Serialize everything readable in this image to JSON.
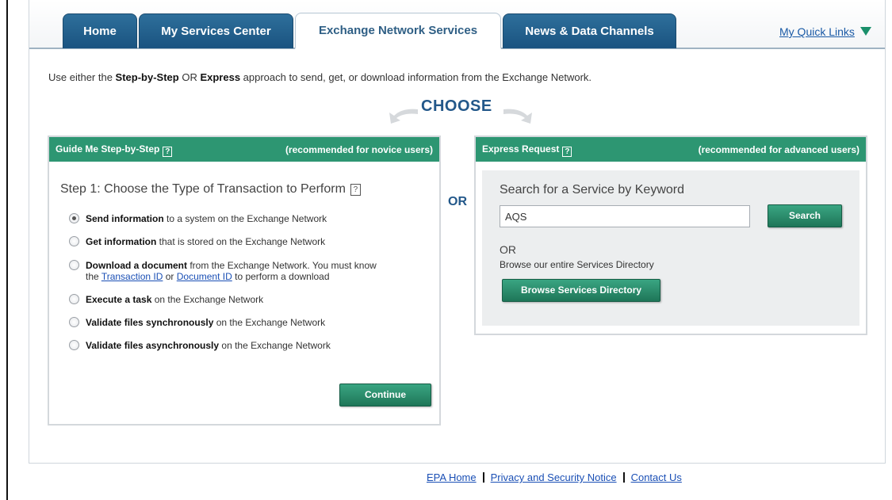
{
  "nav": {
    "tabs": [
      {
        "label": "Home"
      },
      {
        "label": "My Services Center"
      },
      {
        "label": "Exchange Network Services"
      },
      {
        "label": "News & Data Channels"
      }
    ],
    "quick_links": "My Quick Links"
  },
  "intro": {
    "part1": "Use either the ",
    "step": "Step-by-Step",
    "part2": " OR ",
    "express": "Express",
    "part3": " approach to send, get, or download information from the Exchange Network."
  },
  "choose_label": "CHOOSE",
  "or_label": "OR",
  "guide_panel": {
    "title": "Guide Me Step-by-Step",
    "recommendation": "(recommended for novice users)",
    "step_title": "Step 1: Choose the Type of Transaction to Perform",
    "options": [
      {
        "bold": "Send information",
        "rest": " to a system on the Exchange Network",
        "checked": true
      },
      {
        "bold": "Get information",
        "rest": " that is stored on the Exchange Network",
        "checked": false
      },
      {
        "bold": "Download a document",
        "rest": " from the Exchange Network. You must know",
        "line2_pre": "the ",
        "link1": "Transaction ID",
        "line2_mid": " or ",
        "link2": "Document ID",
        "line2_post": " to perform a download",
        "checked": false
      },
      {
        "bold": "Execute a task",
        "rest": " on the Exchange Network",
        "checked": false
      },
      {
        "bold": "Validate files synchronously",
        "rest": " on the Exchange Network",
        "checked": false
      },
      {
        "bold": "Validate files asynchronously",
        "rest": " on the Exchange Network",
        "checked": false
      }
    ],
    "continue_label": "Continue"
  },
  "express_panel": {
    "title": "Express Request",
    "recommendation": "(recommended for advanced users)",
    "search_title": "Search for a Service by Keyword",
    "search_value": "AQS",
    "search_button": "Search",
    "or_label": "OR",
    "browse_text": "Browse our entire Services Directory",
    "browse_button": "Browse Services Directory"
  },
  "help_glyph": "?",
  "footer": {
    "links": [
      "EPA Home",
      "Privacy and Security Notice",
      "Contact Us"
    ]
  },
  "colors": {
    "tab_blue": "#1a5380",
    "panel_green": "#2d9672",
    "link_blue": "#1a4fb5",
    "choose_blue": "#23588a"
  }
}
